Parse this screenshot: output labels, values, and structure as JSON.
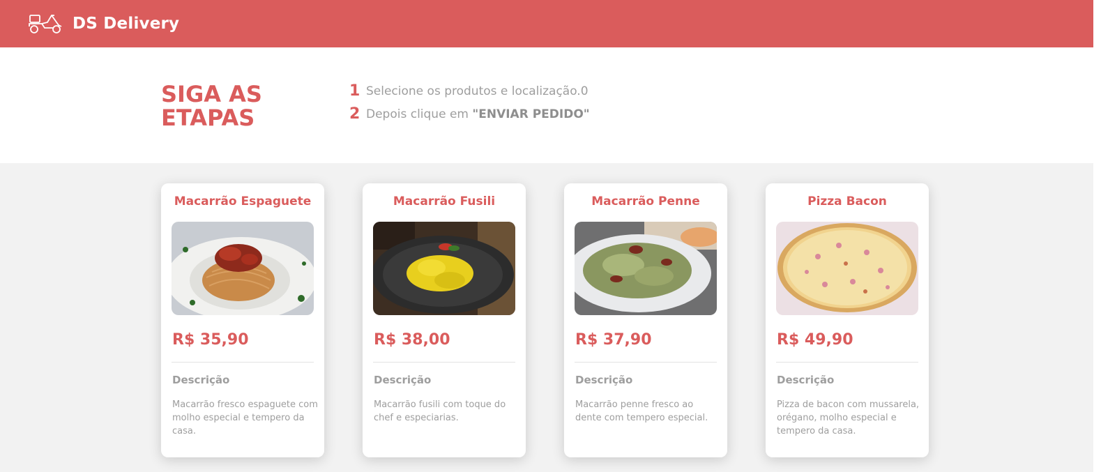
{
  "navbar": {
    "brand": "DS Delivery",
    "logo_icon": "delivery-scooter-icon"
  },
  "steps": {
    "title_line1": "SIGA AS",
    "title_line2": "ETAPAS",
    "items": [
      {
        "number": "1",
        "text": "Selecione os produtos e localização.0",
        "bold": ""
      },
      {
        "number": "2",
        "text": "Depois clique em ",
        "bold": "\"ENVIAR PEDIDO\""
      }
    ]
  },
  "products": [
    {
      "name": "Macarrão Espaguete",
      "price": "R$ 35,90",
      "desc_title": "Descrição",
      "description": "Macarrão fresco espaguete com molho especial e tempero da casa.",
      "image": "spaghetti-photo"
    },
    {
      "name": "Macarrão Fusili",
      "price": "R$ 38,00",
      "desc_title": "Descrição",
      "description": "Macarrão fusili com toque do chef e especiarias.",
      "image": "fusili-photo"
    },
    {
      "name": "Macarrão Penne",
      "price": "R$ 37,90",
      "desc_title": "Descrição",
      "description": "Macarrão penne fresco ao dente com tempero especial.",
      "image": "penne-photo"
    },
    {
      "name": "Pizza Bacon",
      "price": "R$ 49,90",
      "desc_title": "Descrição",
      "description": "Pizza de bacon com mussarela, orégano, molho especial e tempero da casa.",
      "image": "pizza-photo"
    }
  ],
  "colors": {
    "brand": "#da5c5c",
    "text_muted": "#9e9e9e",
    "background": "#f2f2f2"
  }
}
